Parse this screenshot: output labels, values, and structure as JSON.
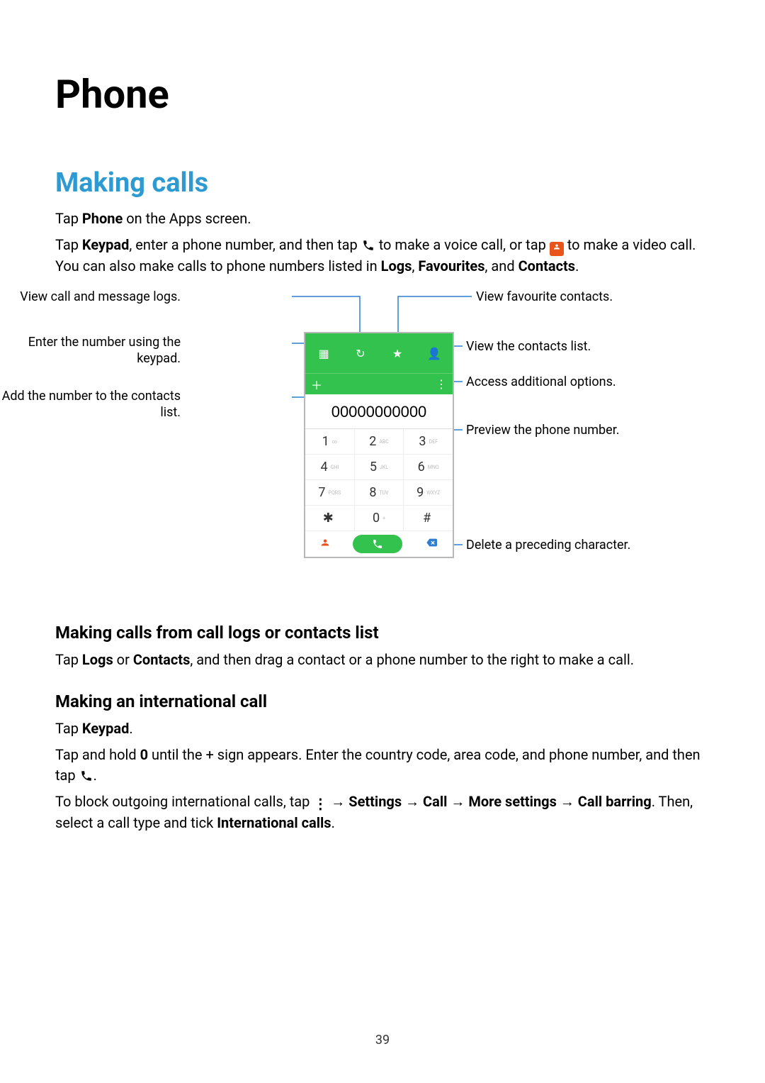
{
  "page": {
    "number": "39",
    "chapter_title": "Phone",
    "section_title": "Making calls"
  },
  "paragraphs": {
    "p1_prefix": "Tap ",
    "p1_bold": "Phone",
    "p1_suffix": " on the Apps screen.",
    "p2_a": "Tap ",
    "p2_bold_keypad": "Keypad",
    "p2_b": ", enter a phone number, and then tap ",
    "p2_c": " to make a voice call, or tap ",
    "p2_d": " to make a video call. You can also make calls to phone numbers listed in ",
    "p2_bold_logs": "Logs",
    "p2_comma1": ", ",
    "p2_bold_fav": "Favourites",
    "p2_comma2": ", and ",
    "p2_bold_contacts": "Contacts",
    "p2_period": "."
  },
  "callouts": {
    "left1": "View call and message logs.",
    "left2": "Enter the number using the keypad.",
    "left3": "Add the number to the contacts list.",
    "right1": "View favourite contacts.",
    "right2": "View the contacts list.",
    "right3": "Access additional options.",
    "right4": "Preview the phone number.",
    "right5": "Delete a preceding character."
  },
  "mock": {
    "number_display": "00000000000",
    "keys": {
      "k1": "1",
      "k1s": "∞",
      "k2": "2",
      "k2s": "ABC",
      "k3": "3",
      "k3s": "DEF",
      "k4": "4",
      "k4s": "GHI",
      "k5": "5",
      "k5s": "JKL",
      "k6": "6",
      "k6s": "MNO",
      "k7": "7",
      "k7s": "PQRS",
      "k8": "8",
      "k8s": "TUV",
      "k9": "9",
      "k9s": "WXYZ",
      "kstar": "✱",
      "kstars": "",
      "k0": "0",
      "k0s": "+",
      "khash": "#",
      "khashs": ""
    }
  },
  "subsections": {
    "s1_title": "Making calls from call logs or contacts list",
    "s1_a": "Tap ",
    "s1_bold_logs": "Logs",
    "s1_b": " or ",
    "s1_bold_contacts": "Contacts",
    "s1_c": ", and then drag a contact or a phone number to the right to make a call.",
    "s2_title": "Making an international call",
    "s2_l1a": "Tap ",
    "s2_l1b": "Keypad",
    "s2_l1c": ".",
    "s2_l2a": "Tap and hold ",
    "s2_l2b": "0",
    "s2_l2c": " until the + sign appears. Enter the country code, area code, and phone number, and then tap ",
    "s2_l2d": ".",
    "s2_l3a": "To block outgoing international calls, tap ",
    "s2_l3b": " → ",
    "s2_l3c": "Settings",
    "s2_l3d": " → ",
    "s2_l3e": "Call",
    "s2_l3f": " → ",
    "s2_l3g": "More settings",
    "s2_l3h": " → ",
    "s2_l3i": "Call barring",
    "s2_l3j": ". Then, select a call type and tick ",
    "s2_l3k": "International calls",
    "s2_l3l": "."
  }
}
